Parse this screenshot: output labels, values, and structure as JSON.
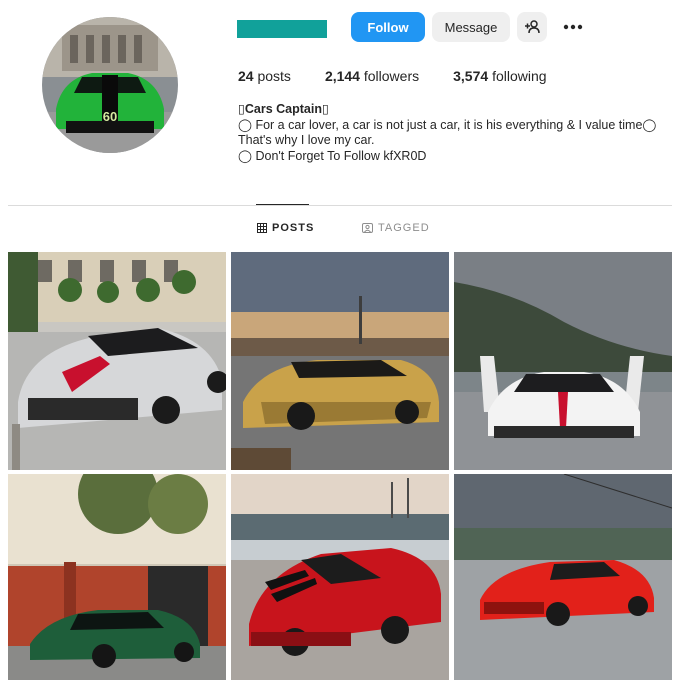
{
  "profile": {
    "follow_label": "Follow",
    "message_label": "Message",
    "more_label": "•••"
  },
  "stats": {
    "posts_count": "24",
    "posts_label": "posts",
    "followers_count": "2,144",
    "followers_label": "followers",
    "following_count": "3,574",
    "following_label": "following"
  },
  "bio": {
    "name": "▯Cars Captain▯",
    "line1": "◯ For a car lover, a car is not just a car, it is his everything & I value time◯",
    "line2": "That's why I love my car.",
    "line3": "◯ Don't Forget To Follow kfXR0D"
  },
  "tabs": {
    "posts_label": "POSTS",
    "tagged_label": "TAGGED"
  },
  "colors": {
    "follow_button": "#2196f3",
    "username_redaction": "#11a19a"
  },
  "posts": [
    {
      "subject": "silver-red-ferrari"
    },
    {
      "subject": "gold-lamborghini"
    },
    {
      "subject": "white-koenigsegg"
    },
    {
      "subject": "green-mercedes-slr"
    },
    {
      "subject": "red-ferrari-spider"
    },
    {
      "subject": "red-ferrari-812"
    }
  ]
}
